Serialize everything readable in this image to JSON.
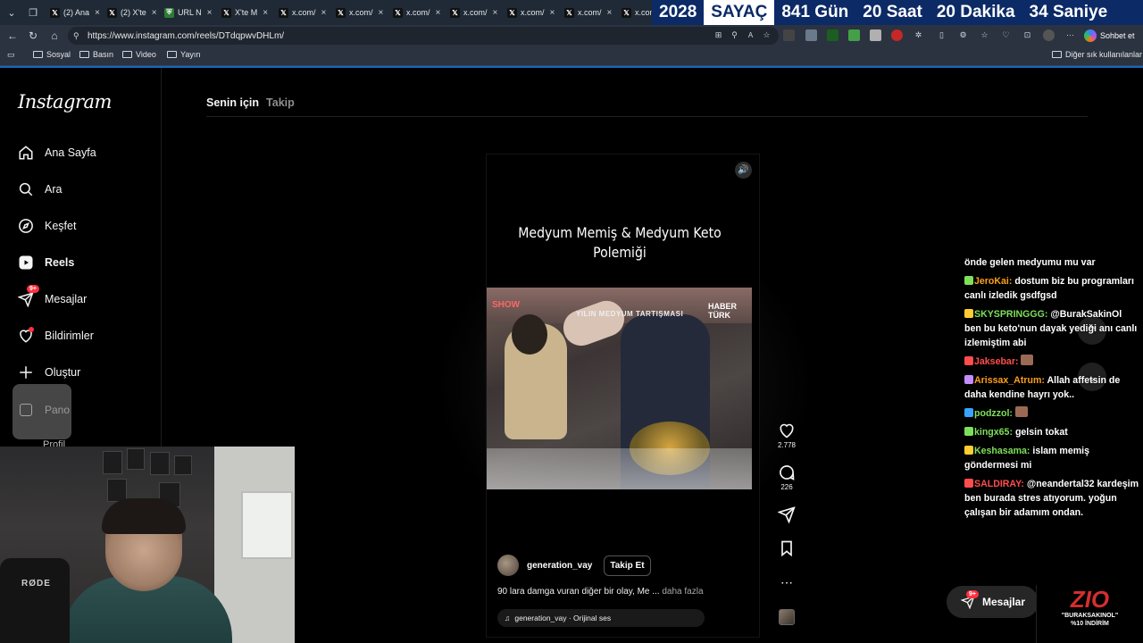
{
  "browser": {
    "tabs": [
      {
        "label": "(2) Ana",
        "icon": "x-logo-icon"
      },
      {
        "label": "(2) X'te",
        "icon": "x-logo-icon"
      },
      {
        "label": "URL N",
        "icon": "url-shortener-icon"
      },
      {
        "label": "X'te M",
        "icon": "x-logo-icon"
      },
      {
        "label": "x.com/",
        "icon": "x-logo-icon"
      },
      {
        "label": "x.com/",
        "icon": "x-logo-icon"
      },
      {
        "label": "x.com/",
        "icon": "x-logo-icon"
      },
      {
        "label": "x.com/",
        "icon": "x-logo-icon"
      },
      {
        "label": "x.com/",
        "icon": "x-logo-icon"
      },
      {
        "label": "x.com/",
        "icon": "x-logo-icon"
      },
      {
        "label": "x.com",
        "icon": "x-logo-icon"
      }
    ],
    "url": "https://www.instagram.com/reels/DTdqpwvDHLm/",
    "copilot_label": "Sohbet et",
    "bookmarks": [
      "Sosyal",
      "Basın",
      "Video",
      "Yayın"
    ],
    "other_bookmarks": "Diğer sık kullanılanlar"
  },
  "countdown": {
    "year": "2028",
    "title": "SAYAÇ",
    "parts": [
      "841 Gün",
      "20 Saat",
      "20 Dakika",
      "34 Saniye"
    ],
    "bg_color": "#0b2a66"
  },
  "instagram": {
    "logo": "Instagram",
    "nav": [
      {
        "label": "Ana Sayfa",
        "icon": "home-icon"
      },
      {
        "label": "Ara",
        "icon": "search-icon"
      },
      {
        "label": "Keşfet",
        "icon": "compass-icon"
      },
      {
        "label": "Reels",
        "icon": "reels-icon",
        "active": true
      },
      {
        "label": "Mesajlar",
        "icon": "messenger-icon",
        "badge": "9+"
      },
      {
        "label": "Bildirimler",
        "icon": "heart-icon"
      },
      {
        "label": "Oluştur",
        "icon": "plus-icon"
      }
    ],
    "pano_label": "Pano",
    "profil_label": "Profil",
    "feed_tabs": {
      "active": "Senin için",
      "inactive": "Takip"
    },
    "reel": {
      "title": "Medyum Memiş & Medyum  Keto Polemiği",
      "video_caption": "YILIN MEDYUM TARTIŞMASI",
      "video_logo_left": "SHOW",
      "video_logo_right": "HABER TÜRK",
      "author": "generation_vay",
      "follow_label": "Takip Et",
      "caption": "90 lara damga vuran diğer bir olay, Me ...",
      "caption_more": "daha fazla",
      "audio": "generation_vay · Orijinal ses",
      "likes": "2.778",
      "comments": "226"
    },
    "messages_pill": {
      "label": "Mesajlar",
      "badge": "9+"
    }
  },
  "chat": [
    {
      "user": "",
      "user_color": "#ffffff",
      "text": "önde gelen medyumu mu var"
    },
    {
      "user": "JeroKai:",
      "user_color": "#ff9f1a",
      "text": "dostum biz bu programları canlı izledik gsdfgsd"
    },
    {
      "user": "SKYSPRINGGG:",
      "user_color": "#7ee05a",
      "text": "@BurakSakinOl ben bu keto'nun dayak yediği anı canlı izlemiştim abi"
    },
    {
      "user": "Jaksebar:",
      "user_color": "#ff4d4d",
      "text": ""
    },
    {
      "user": "Arissax_Atrum:",
      "user_color": "#ff9f1a",
      "text": "Allah affetsin de daha kendine hayrı yok.."
    },
    {
      "user": "podzzol:",
      "user_color": "#7ee05a",
      "text": ""
    },
    {
      "user": "kingx65:",
      "user_color": "#7ee05a",
      "text": "gelsin tokat"
    },
    {
      "user": "Keshasama:",
      "user_color": "#7ee05a",
      "text": "islam memiş göndermesi mi"
    },
    {
      "user": "SALDIRAY:",
      "user_color": "#ff4d4d",
      "text": "@neandertal32 kardeşim ben burada stres atıyorum. yoğun çalışan bir adamım ondan."
    }
  ],
  "sponsor": {
    "logo": "ZIO",
    "text_line1": "\"BURAKSAKINOL\"",
    "text_line2": "%10 İNDİRİM"
  },
  "webcam": {
    "mic_brand": "RØDE"
  }
}
